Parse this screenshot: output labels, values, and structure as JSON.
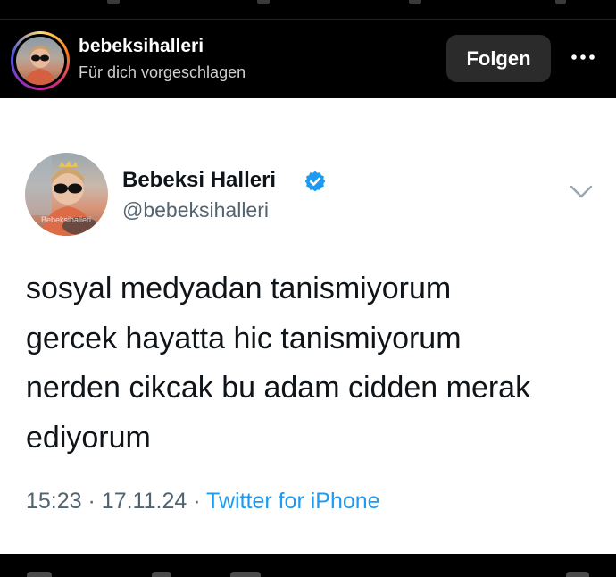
{
  "header": {
    "username": "bebeksihalleri",
    "subtitle": "Für dich vorgeschlagen",
    "follow_label": "Folgen",
    "more_icon": "more-horizontal-icon"
  },
  "tweet": {
    "display_name": "Bebeksi Halleri",
    "handle": "@bebeksihalleri",
    "avatar_watermark": "Bebeksihalleri",
    "verified_icon": "verified-badge-icon",
    "verified_color": "#1d9bf0",
    "menu_icon": "chevron-down-icon",
    "lines": [
      "sosyal medyadan tanismiyorum",
      "gercek hayatta hic tanismiyorum",
      "nerden cikcak bu adam cidden merak",
      "ediyorum"
    ],
    "time": "15:23",
    "separator": "·",
    "date": "17.11.24",
    "source": "Twitter for iPhone",
    "source_color": "#1d9bf0"
  }
}
